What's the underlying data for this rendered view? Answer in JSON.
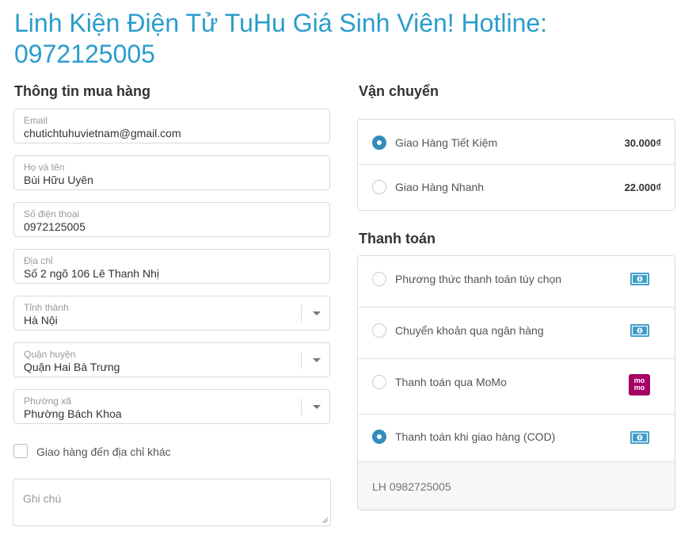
{
  "header": {
    "title": "Linh Kiện Điện Tử TuHu Giá Sinh Viên! Hotline: 0972125005"
  },
  "customer": {
    "title": "Thông tin mua hàng",
    "email": {
      "label": "Email",
      "value": "chutichtuhuvietnam@gmail.com"
    },
    "name": {
      "label": "Họ và tên",
      "value": "Bùi Hữu Uyên"
    },
    "phone": {
      "label": "Số điện thoại",
      "value": "0972125005"
    },
    "address": {
      "label": "Địa chỉ",
      "value": "Số 2 ngõ 106 Lê Thanh Nhị"
    },
    "province": {
      "label": "Tỉnh thành",
      "value": "Hà Nội"
    },
    "district": {
      "label": "Quận huyện",
      "value": "Quận Hai Bà Trưng"
    },
    "ward": {
      "label": "Phường xã",
      "value": "Phường Bách Khoa"
    },
    "ship_other_label": "Giao hàng đến địa chỉ khác",
    "ship_other_checked": false,
    "note_placeholder": "Ghi chú"
  },
  "shipping": {
    "title": "Vận chuyển",
    "options": [
      {
        "label": "Giao Hàng Tiết Kiệm",
        "price": "30.000₫",
        "selected": true
      },
      {
        "label": "Giao Hàng Nhanh",
        "price": "22.000₫",
        "selected": false
      }
    ]
  },
  "payment": {
    "title": "Thanh toán",
    "options": [
      {
        "label": "Phương thức thanh toán tùy chọn",
        "icon": "cash-icon",
        "selected": false
      },
      {
        "label": "Chuyển khoản qua ngân hàng",
        "icon": "cash-icon",
        "selected": false
      },
      {
        "label": "Thanh toán qua MoMo",
        "icon": "momo-icon",
        "selected": false
      },
      {
        "label": "Thanh toán khi giao hàng (COD)",
        "icon": "cash-icon",
        "selected": true
      }
    ],
    "note": "LH 0982725005",
    "momo_logo_top": "mo",
    "momo_logo_bottom": "mo"
  },
  "colors": {
    "accent": "#338dbc",
    "title": "#2a9dcc",
    "cash_icon": "#3d9bc7",
    "momo": "#a50064"
  }
}
